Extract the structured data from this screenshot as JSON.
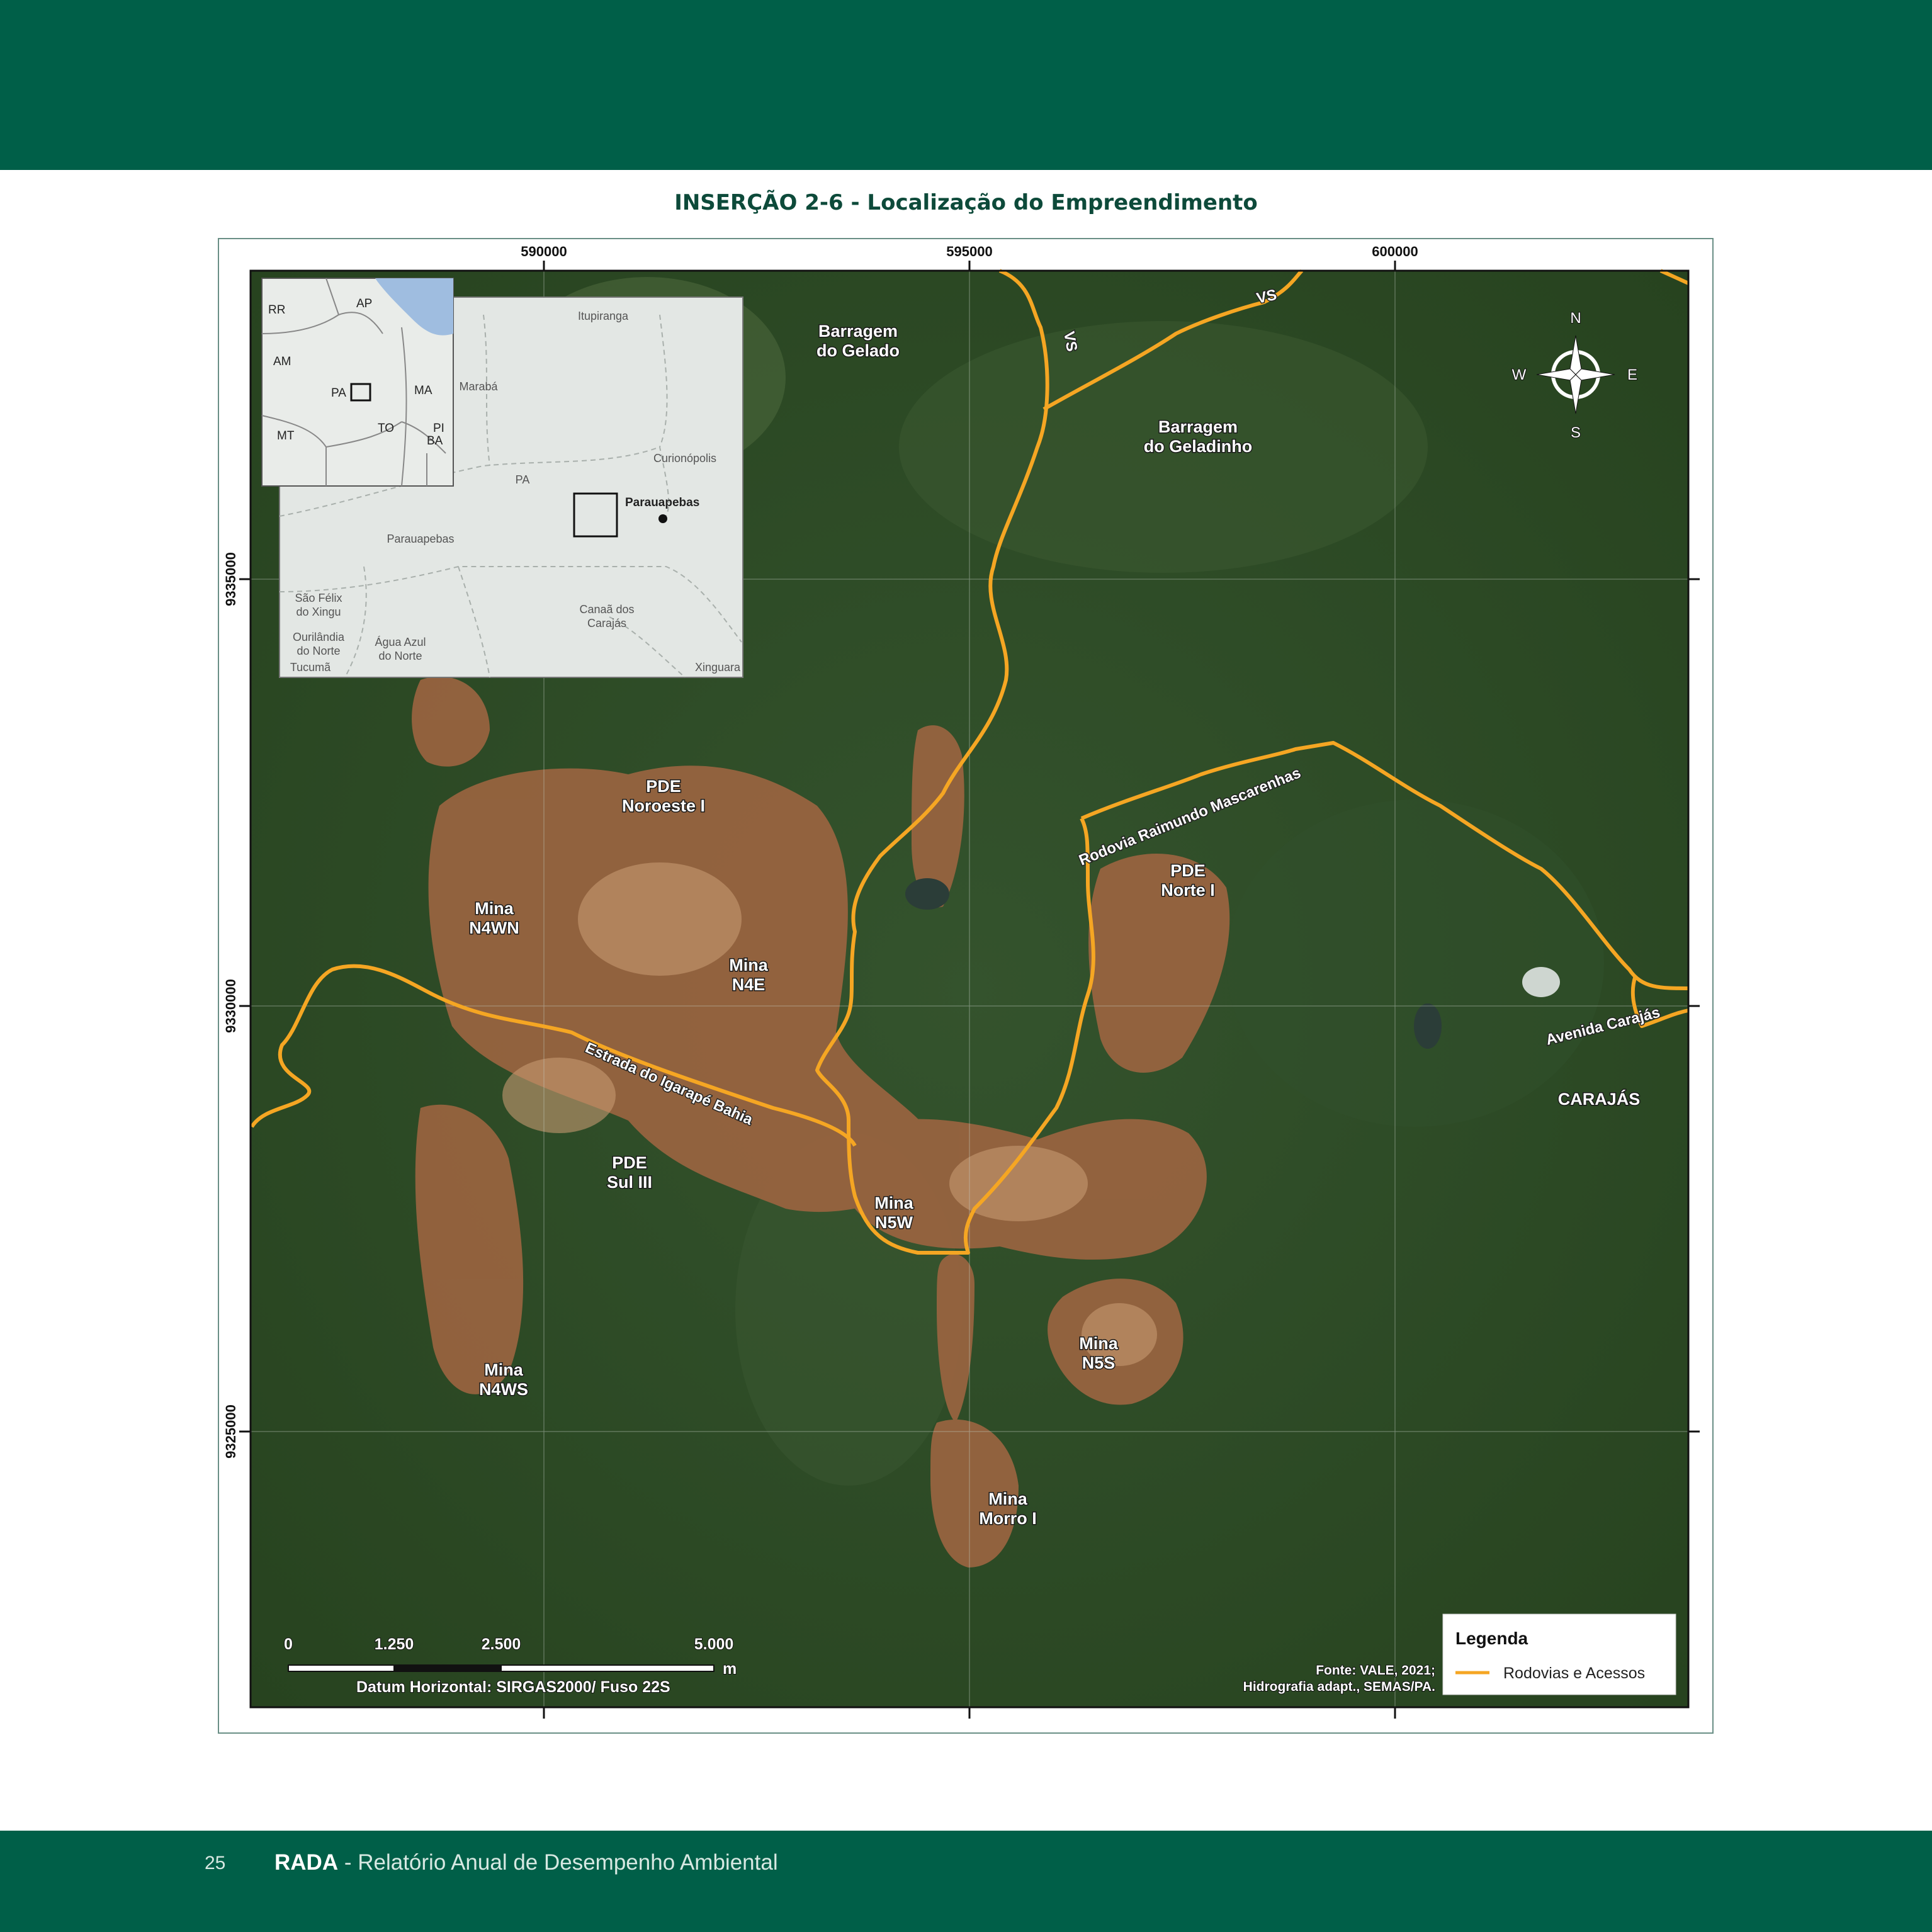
{
  "title": "INSERÇÃO 2-6 - Localização do Empreendimento",
  "footer": {
    "page_number": "25",
    "brand": "RADA",
    "subtitle": " - Relatório Anual de Desempenho Ambiental"
  },
  "map": {
    "grid_labels": {
      "x": [
        "590000",
        "595000",
        "600000"
      ],
      "y": [
        "9335000",
        "9330000",
        "9325000"
      ]
    },
    "features": {
      "barragem_gelado": [
        "Barragem",
        "do Gelado"
      ],
      "barragem_geladinho": [
        "Barragem",
        "do Geladinho"
      ],
      "pde_noroeste": [
        "PDE",
        "Noroeste I"
      ],
      "mina_n4wn": [
        "Mina",
        "N4WN"
      ],
      "mina_n4e": [
        "Mina",
        "N4E"
      ],
      "pde_norte": [
        "PDE",
        "Norte I"
      ],
      "pde_sul": [
        "PDE",
        "Sul III"
      ],
      "mina_n5w": [
        "Mina",
        "N5W"
      ],
      "mina_n5s": [
        "Mina",
        "N5S"
      ],
      "mina_n4ws": [
        "Mina",
        "N4WS"
      ],
      "mina_morro": [
        "Mina",
        "Morro I"
      ],
      "carajas": "CARAJÁS"
    },
    "roads": {
      "estrada": "Estrada do Igarapé Bahia",
      "rodovia": "Rodovia Raimundo Mascarenhas",
      "avenida": "Avenida Carajás",
      "vs1": "VS",
      "vs2": "VS"
    },
    "compass": {
      "n": "N",
      "s": "S",
      "e": "E",
      "w": "W"
    },
    "scale": {
      "ticks": [
        "0",
        "1.250",
        "2.500",
        "5.000"
      ],
      "unit": "m",
      "datum": "Datum Horizontal: SIRGAS2000/ Fuso 22S"
    },
    "source": [
      "Fonte: VALE, 2021;",
      "Hidrografia adapt., SEMAS/PA."
    ],
    "legend": {
      "title": "Legenda",
      "items": [
        {
          "label": "Rodovias e Acessos",
          "color": "#f5a623"
        }
      ]
    },
    "inset_states": {
      "rr": "RR",
      "ap": "AP",
      "am": "AM",
      "pa": "PA",
      "ma": "MA",
      "mt": "MT",
      "to": "TO",
      "pi": "PI",
      "ba": "BA"
    },
    "inset_places": {
      "itupiranga": "Itupiranga",
      "maraba": "Marabá",
      "curionopolis": "Curionópolis",
      "pa": "PA",
      "parauapebas_town": "Parauapebas",
      "parauapebas_muni": "Parauapebas",
      "sao_felix": [
        "São Félix",
        "do Xingu"
      ],
      "canaa": [
        "Canaã dos",
        "Carajás"
      ],
      "ourilandia": [
        "Ourilândia",
        "do Norte"
      ],
      "agua_azul": [
        "Água Azul",
        "do Norte"
      ],
      "tucuma": "Tucumã",
      "xinguara": "Xinguara"
    },
    "colors": {
      "road": "#f5a623",
      "forest": "#2c4a26",
      "mining": "#9a6440",
      "band": "#005f48"
    }
  }
}
